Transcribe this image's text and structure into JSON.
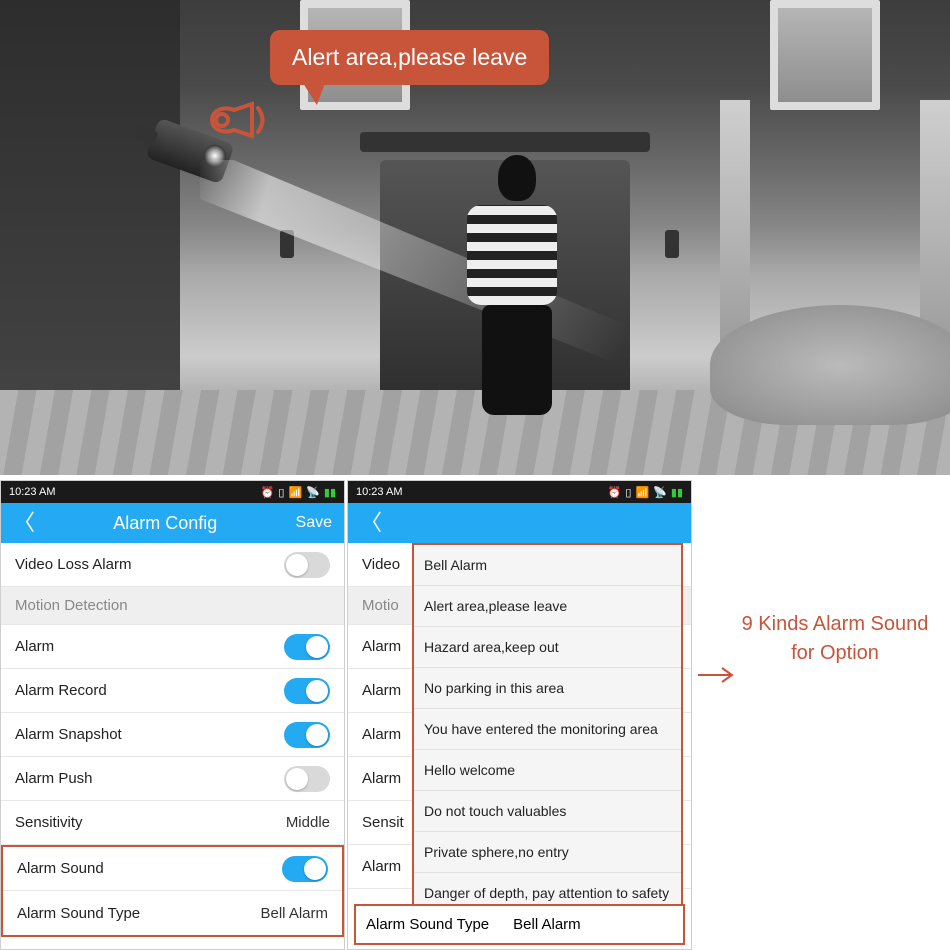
{
  "hero": {
    "speech_text": "Alert area,please leave"
  },
  "statusbar": {
    "time": "10:23 AM"
  },
  "navbar": {
    "title": "Alarm Config",
    "save": "Save"
  },
  "rows": {
    "video_loss": "Video Loss Alarm",
    "motion_section": "Motion Detection",
    "alarm": "Alarm",
    "alarm_record": "Alarm Record",
    "alarm_snapshot": "Alarm Snapshot",
    "alarm_push": "Alarm Push",
    "sensitivity_label": "Sensitivity",
    "sensitivity_value": "Middle",
    "alarm_sound": "Alarm Sound",
    "alarm_sound_type_label": "Alarm Sound Type",
    "alarm_sound_type_value": "Bell Alarm"
  },
  "panel2_rows": {
    "video": "Video",
    "motion": "Motio",
    "alarm": "Alarm",
    "alarm2": "Alarm",
    "alarm3": "Alarm",
    "alarm4": "Alarm",
    "sensit": "Sensit",
    "alarm5": "Alarm"
  },
  "sound_options": [
    "Bell Alarm",
    "Alert area,please leave",
    "Hazard area,keep out",
    "No parking in this area",
    "You have entered the monitoring area",
    "Hello welcome",
    "Do not touch valuables",
    "Private sphere,no entry",
    "Danger of depth, pay attention to safety"
  ],
  "caption": {
    "line1": "9 Kinds Alarm Sound",
    "line2": "for Option"
  }
}
